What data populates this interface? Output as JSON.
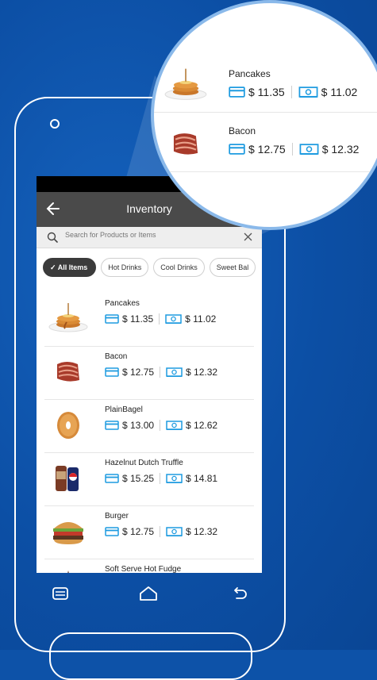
{
  "colors": {
    "background": "#0d52a8",
    "accent": "#1e9be0",
    "appbar": "#4a4a4a"
  },
  "appbar": {
    "title": "Inventory",
    "back_icon": "arrow-left-icon"
  },
  "search": {
    "placeholder": "Search for Products or Items",
    "value": ""
  },
  "chips": [
    {
      "label": "All Items",
      "active": true
    },
    {
      "label": "Hot Drinks",
      "active": false
    },
    {
      "label": "Cool Drinks",
      "active": false
    },
    {
      "label": "Sweet Bal",
      "active": false
    }
  ],
  "items": [
    {
      "name": "Pancakes",
      "card_price": "$ 11.35",
      "cash_price": "$ 11.02",
      "image": "pancakes"
    },
    {
      "name": "Bacon",
      "card_price": "$ 12.75",
      "cash_price": "$ 12.32",
      "image": "bacon"
    },
    {
      "name": "PlainBagel",
      "card_price": "$ 13.00",
      "cash_price": "$ 12.62",
      "image": "bagel"
    },
    {
      "name": "Hazelnut Dutch Truffle",
      "card_price": "$ 15.25",
      "cash_price": "$ 14.81",
      "image": "drinks"
    },
    {
      "name": "Burger",
      "card_price": "$ 12.75",
      "cash_price": "$ 12.32",
      "image": "burger"
    },
    {
      "name": "Soft Serve Hot Fudge",
      "card_price": "",
      "cash_price": "",
      "image": "sundae"
    }
  ],
  "navbar": [
    "recents-icon",
    "home-icon",
    "back-icon"
  ],
  "magnifier": [
    {
      "name": "Pancakes",
      "card_price": "$ 11.35",
      "cash_price": "$ 11.02"
    },
    {
      "name": "Bacon",
      "card_price": "$ 12.75",
      "cash_price": "$ 12.32"
    }
  ]
}
